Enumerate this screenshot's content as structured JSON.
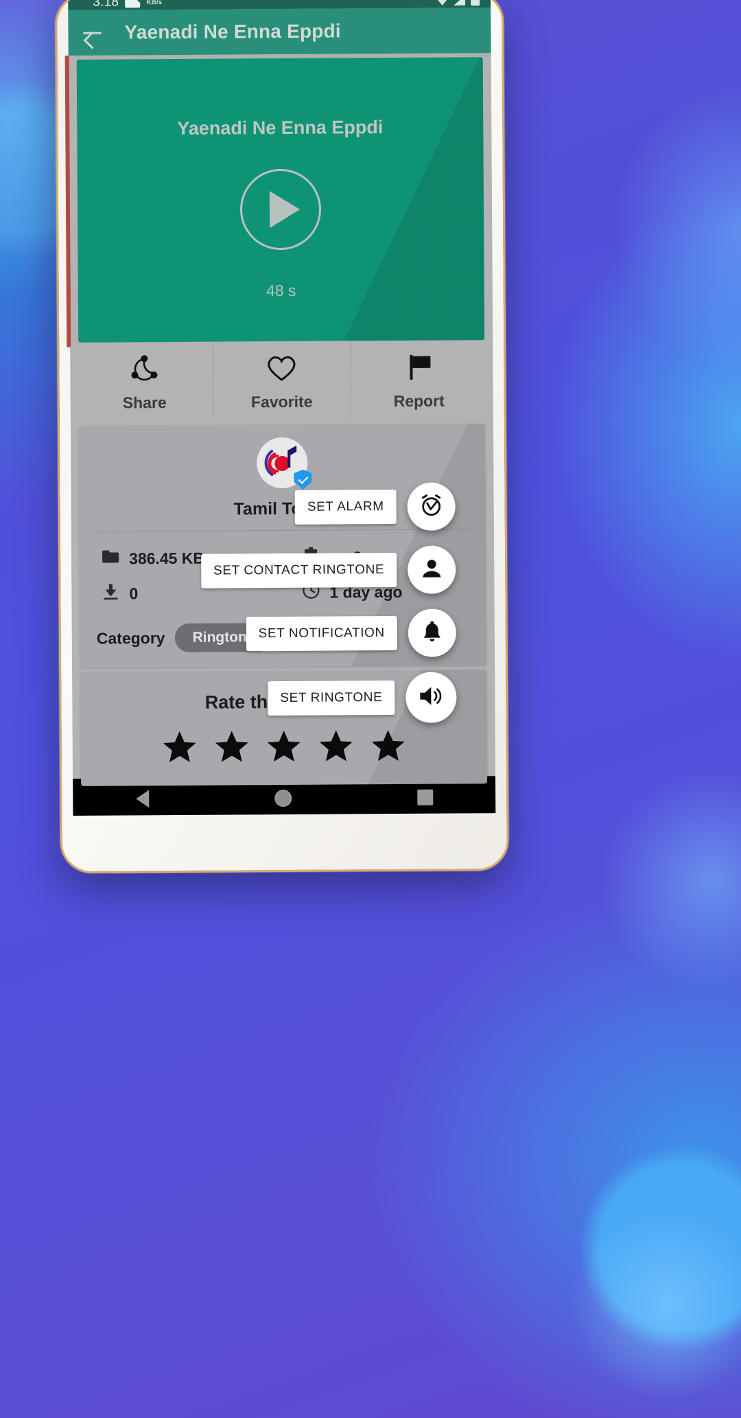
{
  "status_bar": {
    "network_speed": "3.18",
    "speed_unit": "KB/s",
    "icons": [
      "download-icon",
      "wifi-icon",
      "signal-icon",
      "battery-icon"
    ]
  },
  "app_bar": {
    "back_icon": "back-arrow-icon",
    "title": "Yaenadi Ne Enna Eppdi"
  },
  "player": {
    "title": "Yaenadi Ne Enna Eppdi",
    "play_icon": "play-icon",
    "duration": "48 s",
    "background_color": "#0f9375"
  },
  "actions": [
    {
      "label": "Share",
      "icon": "share-icon"
    },
    {
      "label": "Favorite",
      "icon": "heart-icon"
    },
    {
      "label": "Report",
      "icon": "flag-icon"
    }
  ],
  "publisher": {
    "logo_icon": "music-note-logo-icon",
    "verified_icon": "verified-badge-icon",
    "name": "Tamil Tones"
  },
  "meta": [
    {
      "icon": "folder-icon",
      "value": "386.45 KB"
    },
    {
      "icon": "puzzle-icon",
      "value": "mp3"
    },
    {
      "icon": "download-icon",
      "value": "0"
    },
    {
      "icon": "clock-icon",
      "value": "1 day ago"
    }
  ],
  "category": {
    "label": "Category",
    "chip": "Ringtone"
  },
  "rating": {
    "title": "Rate this ringtone",
    "stars_total": 5,
    "stars_filled": 5,
    "star_icon": "star-icon"
  },
  "fab_menu": {
    "items": [
      {
        "label": "SET ALARM",
        "icon": "alarm-clock-icon"
      },
      {
        "label": "SET CONTACT RINGTONE",
        "icon": "person-icon"
      },
      {
        "label": "SET NOTIFICATION",
        "icon": "bell-icon"
      }
    ],
    "main": {
      "label": "SET RINGTONE",
      "icon": "volume-up-icon"
    }
  },
  "nav_bar": {
    "back": "nav-back-icon",
    "home": "nav-home-icon",
    "recent": "nav-recent-icon"
  },
  "colors": {
    "accent_green": "#0f9375",
    "appbar_green": "#28907a",
    "statusbar_green": "#1f6354",
    "verified_blue": "#2196f3"
  }
}
